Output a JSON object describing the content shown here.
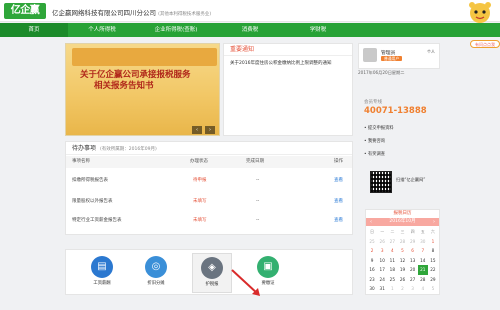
{
  "header": {
    "logo_text": "亿企赢",
    "company_name": "亿企赢网络科技有限公司四川分公司",
    "company_note": "(其他本利得税技术服务业)",
    "help_badge": "有问点点我"
  },
  "nav": {
    "items": [
      {
        "label": "首页"
      },
      {
        "label": "个人所得税"
      },
      {
        "label": "企业所得税(查账)"
      },
      {
        "label": "消费税"
      },
      {
        "label": "学财税"
      }
    ]
  },
  "banner": {
    "line1": "关于亿企赢公司承接报税服务",
    "line2": "相关报务告知书"
  },
  "notice": {
    "title": "重要通知",
    "items": [
      {
        "text": "关于2016年度住房公积金缴纳比例上限调整的通知"
      }
    ]
  },
  "todo": {
    "title": "待办事项",
    "subtitle": "(有效所属期：2016年09月)",
    "columns": [
      "事项名称",
      "办理状态",
      "完成日期",
      "操作"
    ],
    "rows": [
      {
        "name": "扣缴所得税报告表",
        "status": "待申报",
        "date": "--",
        "action": "查看"
      },
      {
        "name": "限量股权以外报告表",
        "status": "未填写",
        "date": "--",
        "action": "查看"
      },
      {
        "name": "特定行业工资薪金报告表",
        "status": "未填写",
        "date": "--",
        "action": "查看"
      }
    ]
  },
  "tiles": [
    {
      "label": "工资薪酬",
      "icon": "wallet-icon"
    },
    {
      "label": "折旧分摊",
      "icon": "depreciation-icon"
    },
    {
      "label": "护税报",
      "icon": "layers-icon"
    },
    {
      "label": "要缴证",
      "icon": "certificate-icon"
    }
  ],
  "user": {
    "name": "管理员",
    "badge": "普通用户",
    "center": "个人",
    "date": "2017年06月20日星期二"
  },
  "service": {
    "label": "会员专线",
    "phone": "40071-13888",
    "links": [
      {
        "text": "• 提交申报资料"
      },
      {
        "text": "• 我要咨询"
      },
      {
        "text": "• 有奖调查"
      }
    ],
    "qr_text": "扫描“亿企赢网”"
  },
  "calendar": {
    "title": "报税日历",
    "month": "2016年10月",
    "weekdays": [
      "日",
      "一",
      "二",
      "三",
      "四",
      "五",
      "六"
    ],
    "days": [
      {
        "d": "25",
        "t": "dim"
      },
      {
        "d": "26",
        "t": "dim"
      },
      {
        "d": "27",
        "t": "dim"
      },
      {
        "d": "28",
        "t": "dim"
      },
      {
        "d": "29",
        "t": "dim"
      },
      {
        "d": "30",
        "t": "dim"
      },
      {
        "d": "1",
        "t": "mark"
      },
      {
        "d": "2",
        "t": "mark"
      },
      {
        "d": "3",
        "t": "mark"
      },
      {
        "d": "4",
        "t": "mark"
      },
      {
        "d": "5",
        "t": "mark"
      },
      {
        "d": "6",
        "t": "mark"
      },
      {
        "d": "7",
        "t": "mark"
      },
      {
        "d": "8",
        "t": ""
      },
      {
        "d": "9",
        "t": ""
      },
      {
        "d": "10",
        "t": ""
      },
      {
        "d": "11",
        "t": ""
      },
      {
        "d": "12",
        "t": ""
      },
      {
        "d": "13",
        "t": ""
      },
      {
        "d": "14",
        "t": ""
      },
      {
        "d": "15",
        "t": ""
      },
      {
        "d": "16",
        "t": ""
      },
      {
        "d": "17",
        "t": ""
      },
      {
        "d": "18",
        "t": ""
      },
      {
        "d": "19",
        "t": ""
      },
      {
        "d": "20",
        "t": ""
      },
      {
        "d": "21",
        "t": "today"
      },
      {
        "d": "22",
        "t": ""
      },
      {
        "d": "23",
        "t": ""
      },
      {
        "d": "24",
        "t": ""
      },
      {
        "d": "25",
        "t": ""
      },
      {
        "d": "26",
        "t": ""
      },
      {
        "d": "27",
        "t": ""
      },
      {
        "d": "28",
        "t": ""
      },
      {
        "d": "29",
        "t": ""
      },
      {
        "d": "30",
        "t": ""
      },
      {
        "d": "31",
        "t": ""
      },
      {
        "d": "1",
        "t": "dim"
      },
      {
        "d": "2",
        "t": "dim"
      },
      {
        "d": "3",
        "t": "dim"
      },
      {
        "d": "4",
        "t": "dim"
      },
      {
        "d": "5",
        "t": "dim"
      }
    ]
  },
  "colors": {
    "brand_green": "#27a236",
    "accent_orange": "#f08030",
    "alert_red": "#e5533a"
  }
}
